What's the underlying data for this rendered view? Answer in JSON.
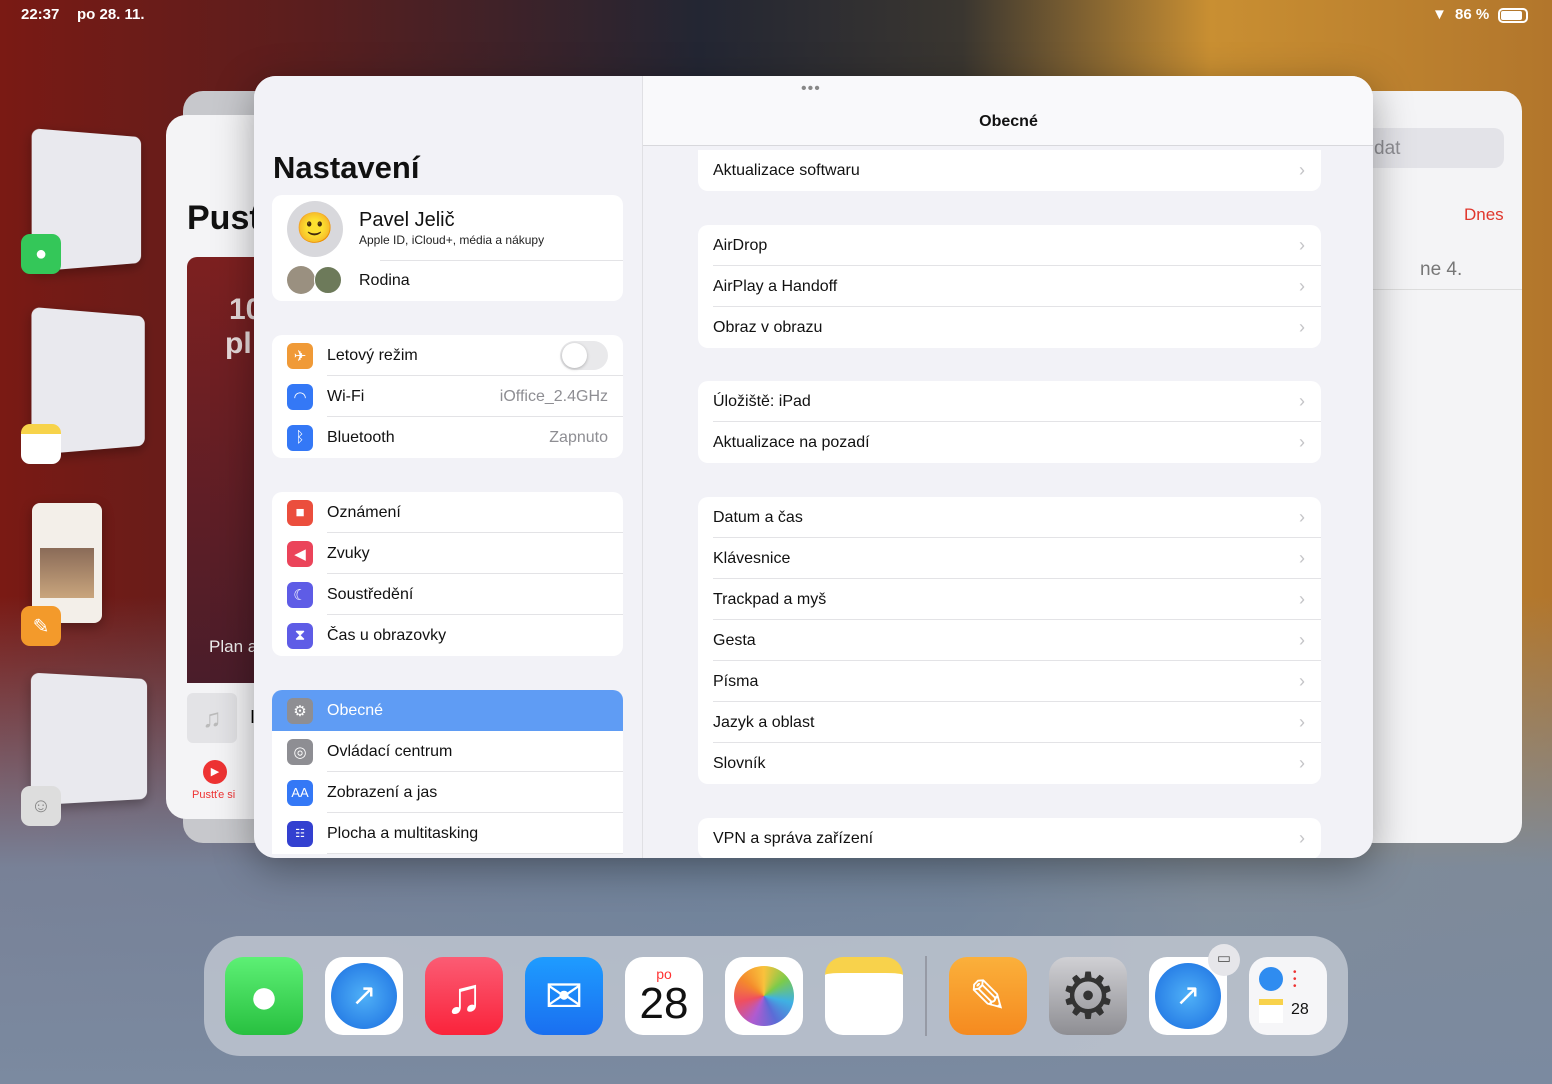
{
  "status": {
    "time": "22:37",
    "date": "po 28. 11.",
    "battery": "86 %",
    "battery_level": 0.86
  },
  "bg_left": {
    "title": "Pust",
    "card_line1": "10",
    "card_line2": "pl",
    "card_caption": "Plan a",
    "play_label": "Pustťe si",
    "mini_letter": "I"
  },
  "bg_right": {
    "search_placeholder": "dat",
    "today": "Dnes",
    "date_text": "ne 4."
  },
  "sidebar": {
    "title": "Nastavení",
    "profile": {
      "name": "Pavel Jelič",
      "subtitle": "Apple ID, iCloud+, média a nákupy",
      "family": "Rodina"
    },
    "connectivity": [
      {
        "label": "Letový režim",
        "toggle": false
      },
      {
        "label": "Wi-Fi",
        "value": "iOffice_2.4GHz"
      },
      {
        "label": "Bluetooth",
        "value": "Zapnuto"
      }
    ],
    "notifications": [
      {
        "label": "Oznámení"
      },
      {
        "label": "Zvuky"
      },
      {
        "label": "Soustředění"
      },
      {
        "label": "Čas u obrazovky"
      }
    ],
    "general": [
      {
        "label": "Obecné",
        "selected": true
      },
      {
        "label": "Ovládací centrum"
      },
      {
        "label": "Zobrazení a jas"
      },
      {
        "label": "Plocha a multitasking"
      }
    ],
    "accent": "#5f9cf4"
  },
  "detail": {
    "title": "Obecné",
    "groups": [
      [
        "Aktualizace softwaru"
      ],
      [
        "AirDrop",
        "AirPlay a Handoff",
        "Obraz v obrazu"
      ],
      [
        "Úložiště: iPad",
        "Aktualizace na pozadí"
      ],
      [
        "Datum a čas",
        "Klávesnice",
        "Trackpad a myš",
        "Gesta",
        "Písma",
        "Jazyk a oblast",
        "Slovník"
      ],
      [
        "VPN a správa zařízení"
      ]
    ]
  },
  "dock": {
    "calendar_day": "po",
    "calendar_date": "28",
    "stack_date": "28"
  }
}
